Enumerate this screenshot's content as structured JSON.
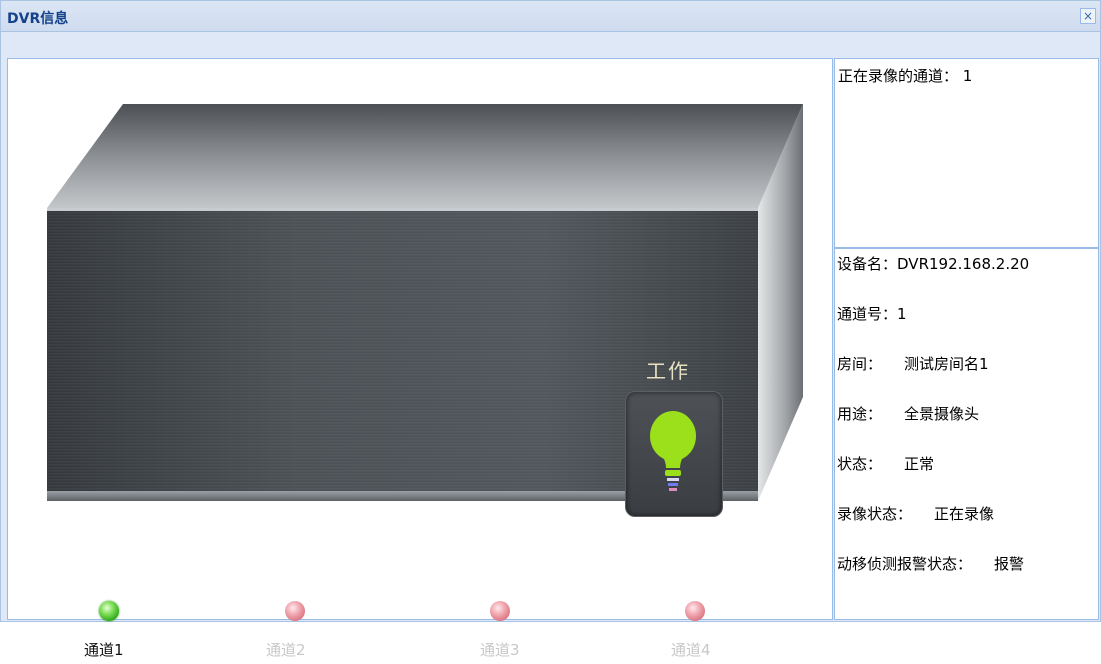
{
  "window": {
    "title": "DVR信息",
    "close_label": "×"
  },
  "device": {
    "work_label": "工作",
    "channels": [
      {
        "label": "通道1",
        "active": true
      },
      {
        "label": "通道2",
        "active": false
      },
      {
        "label": "通道3",
        "active": false
      },
      {
        "label": "通道4",
        "active": false
      }
    ]
  },
  "recording": {
    "label": "正在录像的通道：",
    "value": "1"
  },
  "info": {
    "device_name_label": "设备名：",
    "device_name_value": "DVR192.168.2.20",
    "channel_no_label": "通道号：",
    "channel_no_value": "1",
    "room_label": "房间：",
    "room_value": "测试房间名1",
    "usage_label": "用途：",
    "usage_value": "全景摄像头",
    "status_label": "状态：",
    "status_value": "正常",
    "record_status_label": "录像状态：",
    "record_status_value": "正在录像",
    "motion_label": "动移侦测报警状态：",
    "motion_value": "报警"
  },
  "colors": {
    "title_text": "#15428b",
    "border": "#99bbe8",
    "bulb": "#9be01a",
    "led_on": "#3bb21f",
    "led_off": "#e08890"
  },
  "icons": {
    "close": "close-icon",
    "bulb": "light-bulb-icon",
    "led": "status-led-icon"
  }
}
